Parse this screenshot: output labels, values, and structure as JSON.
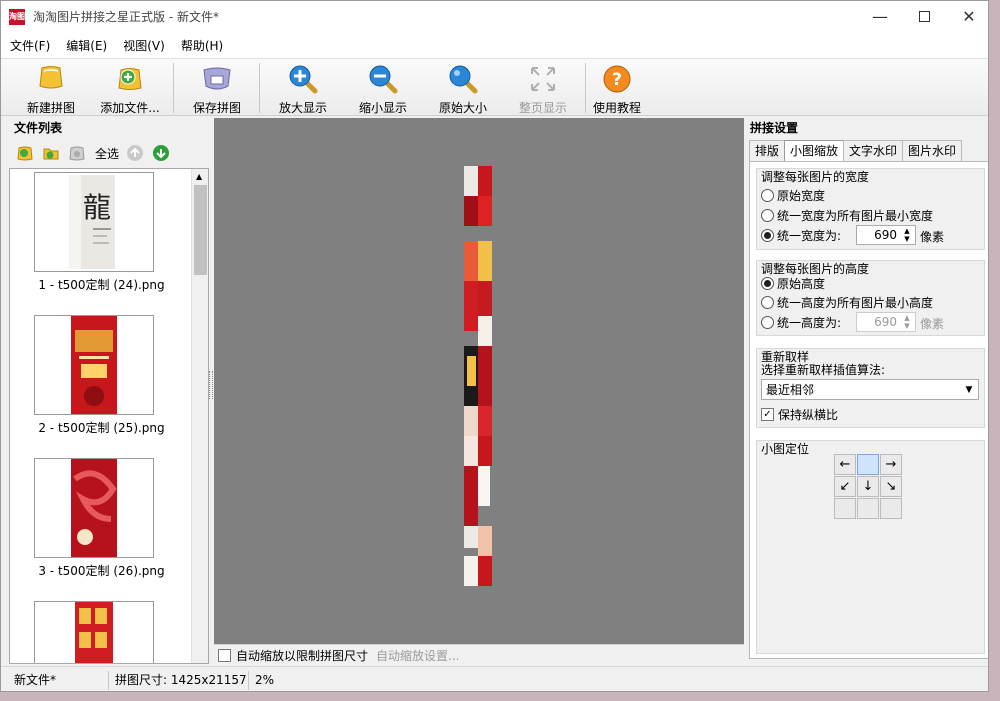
{
  "window": {
    "title": "淘淘图片拼接之星正式版 - 新文件*",
    "icon_text": "淘图"
  },
  "menu": [
    "文件(F)",
    "编辑(E)",
    "视图(V)",
    "帮助(H)"
  ],
  "toolbar": {
    "new": "新建拼图",
    "add": "添加文件...",
    "save": "保存拼图",
    "zoom_in": "放大显示",
    "zoom_out": "缩小显示",
    "original": "原始大小",
    "fit": "整页显示",
    "tutorial": "使用教程"
  },
  "file_panel": {
    "title": "文件列表",
    "select_all": "全选",
    "files": [
      "1 - t500定制 (24).png",
      "2 - t500定制 (25).png",
      "3 - t500定制 (26).png"
    ]
  },
  "canvas": {
    "auto_scale_label": "自动缩放以限制拼图尺寸",
    "auto_scale_settings": "自动缩放设置..."
  },
  "settings": {
    "title": "拼接设置",
    "tabs": [
      "排版",
      "小图缩放",
      "文字水印",
      "图片水印"
    ],
    "width_group": {
      "title": "调整每张图片的宽度",
      "options": [
        "原始宽度",
        "统一宽度为所有图片最小宽度",
        "统一宽度为:"
      ],
      "value": "690",
      "unit": "像素"
    },
    "height_group": {
      "title": "调整每张图片的高度",
      "options": [
        "原始高度",
        "统一高度为所有图片最小高度",
        "统一高度为:"
      ],
      "value": "690",
      "unit": "像素"
    },
    "resample_group": {
      "title": "重新取样",
      "label": "选择重新取样插值算法:",
      "selected": "最近相邻",
      "keep_ratio": "保持纵横比"
    },
    "position_group": {
      "title": "小图定位"
    }
  },
  "status": {
    "file": "新文件*",
    "size": "拼图尺寸: 1425x21157",
    "zoom": "2%"
  }
}
